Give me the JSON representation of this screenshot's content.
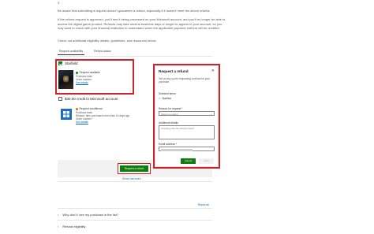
{
  "page": {
    "step": "3",
    "intro": "Be aware that submitting a request doesn't guarantee a refund, especially if it doesn't meet the above criteria.",
    "para2": "If the refund request is approved, you'll see it being processed on your Microsoft account, and you'll no longer be able to access the digital game product. Refunds may take several business days or longer to appear in your account, so you may want to check with your financial institution to understand when the applicable payment method will be credited.",
    "para3": "Check out additional eligibility details, guidelines, and resources below."
  },
  "tabs": [
    {
      "label": "Request availability",
      "active": true
    },
    {
      "label": "Refund status",
      "active": false
    }
  ],
  "items": {
    "starfield": {
      "title": "Starfield",
      "checked": true,
      "status": "Request available",
      "purchase_date": "Purchase date:",
      "order_number": "Order number:",
      "details_link": "See details"
    },
    "credit": {
      "title": "$30.00 credit to Microsoft account",
      "checked": false,
      "status": "Request conditional",
      "purchase_date": "Purchase date:",
      "order_number": "Order number:",
      "reason": "Reason: Item purchased more than 14 days ago",
      "details_link": "See details"
    }
  },
  "show_more": "Show me more",
  "submit_button": "Request a refund",
  "report": "Report all",
  "accordions": [
    "Why don't I see my purchase in the list?",
    "Refund eligibility"
  ],
  "modal": {
    "title": "Request a refund",
    "close_glyph": "✕",
    "description": "Tell us why you're requesting a refund for your purchase.",
    "selected_items_label": "Selected items",
    "selected_item": "Starfield",
    "reason_label": "Reason for request *",
    "reason_placeholder": "Select an option",
    "details_label": "Additional details",
    "details_placeholder": "Anything else we should know?",
    "email_label": "Email address *",
    "cancel_button": "Cancel",
    "next_button": "Next"
  },
  "colors": {
    "accent_green": "#107c10",
    "highlight_red": "#d0242b",
    "link_blue": "#0067b8"
  }
}
